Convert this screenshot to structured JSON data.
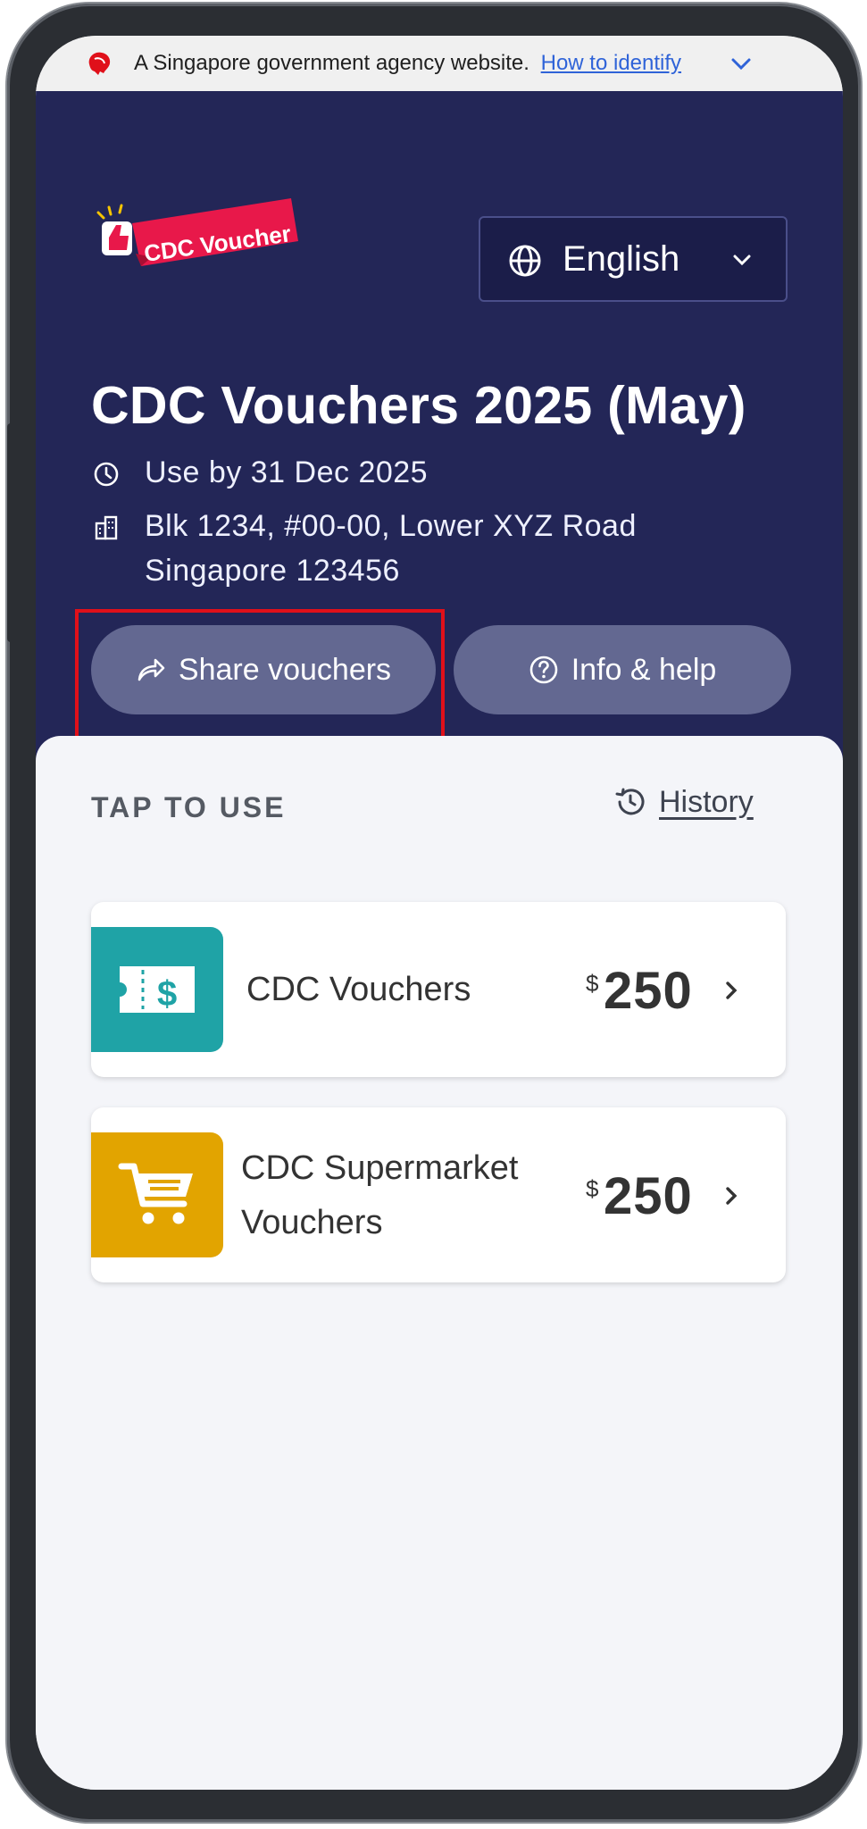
{
  "gov_banner": {
    "text": "A Singapore government agency website.",
    "link": "How to identify"
  },
  "header": {
    "logo_text": "CDC Voucher",
    "language": "English",
    "title": "CDC Vouchers 2025 (May)",
    "expiry": "Use by 31 Dec 2025",
    "address_line1": "Blk 1234, #00-00, Lower XYZ Road",
    "address_line2": "Singapore 123456",
    "share_label": "Share vouchers",
    "help_label": "Info & help"
  },
  "main": {
    "section_label": "TAP TO USE",
    "history_label": "History",
    "vouchers": [
      {
        "name": "CDC Vouchers",
        "currency": "$",
        "amount": "250",
        "icon": "voucher-ticket-icon",
        "color": "#1fa3a6"
      },
      {
        "name_line1": "CDC Supermarket",
        "name_line2": "Vouchers",
        "currency": "$",
        "amount": "250",
        "icon": "cart-icon",
        "color": "#e2a400"
      }
    ]
  },
  "colors": {
    "header_bg": "#232657",
    "pill_bg": "#636891",
    "highlight": "#e0101a",
    "brand_red": "#e8184a"
  }
}
